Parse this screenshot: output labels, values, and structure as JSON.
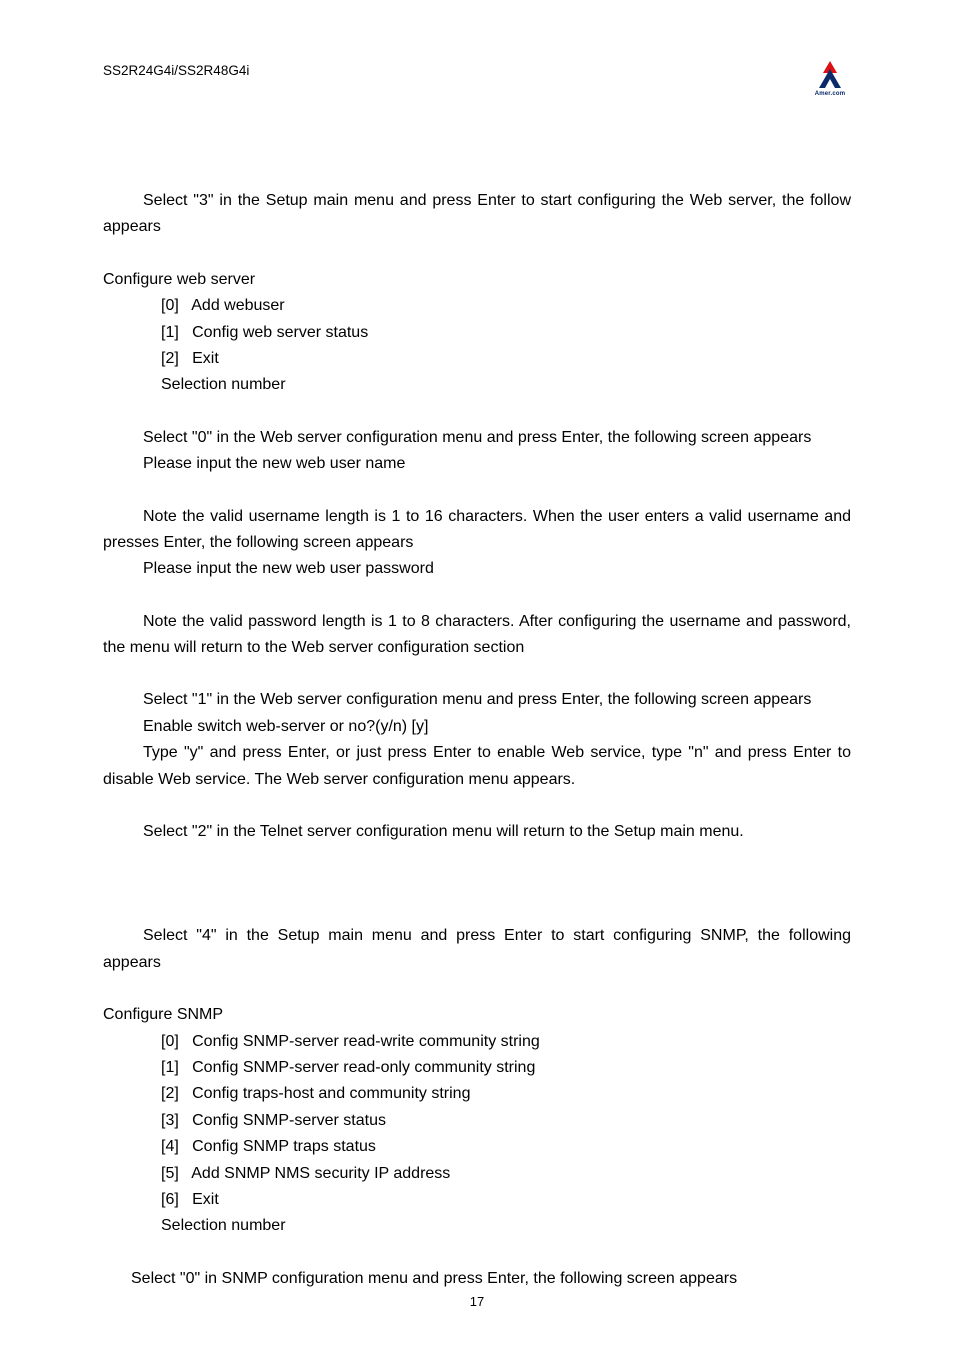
{
  "header": {
    "model": "SS2R24G4i/SS2R48G4i",
    "logo_brand": "Amer.com"
  },
  "section1": {
    "intro": "Select \"3\" in the Setup main menu and press Enter to start configuring the Web server, the follow appears",
    "menu_title": "Configure web server",
    "menu_items": [
      "[0]   Add webuser",
      "[1]   Config web server status",
      "[2]   Exit",
      "Selection number"
    ],
    "p1a": "Select \"0\" in the Web server configuration menu and press Enter, the following screen appears",
    "p1b": "Please input the new web user name",
    "p2a": "Note   the valid username length is 1 to 16 characters. When the user enters a valid username and presses Enter, the following screen appears",
    "p2b": "Please input the new web user password",
    "p3": "Note   the valid password length is 1 to 8 characters. After configuring the username and password, the menu will return to the Web server configuration section",
    "p4a": "Select \"1\" in the Web   server configuration menu and press Enter, the following screen appears",
    "p4b": "Enable switch web-server or no?(y/n) [y]",
    "p4c": "Type \"y\" and press Enter, or just press Enter to enable Web service, type \"n\" and press Enter to disable Web service. The Web server configuration menu appears.",
    "p5": "Select \"2\" in the Telnet server configuration menu will return to the Setup main menu."
  },
  "section2": {
    "intro": "Select \"4\" in the Setup main menu and press Enter to start configuring SNMP, the following appears",
    "menu_title": "Configure SNMP",
    "menu_items": [
      "[0]   Config SNMP-server read-write community string",
      "[1]   Config SNMP-server read-only community string",
      "[2]   Config traps-host and community string",
      "[3]   Config SNMP-server status",
      "[4]   Config SNMP traps status",
      "[5]   Add SNMP NMS security IP address",
      "[6]   Exit",
      "Selection number"
    ],
    "p1": "Select \"0\" in SNMP configuration menu and press Enter, the following screen appears"
  },
  "footer": {
    "page_number": "17"
  }
}
